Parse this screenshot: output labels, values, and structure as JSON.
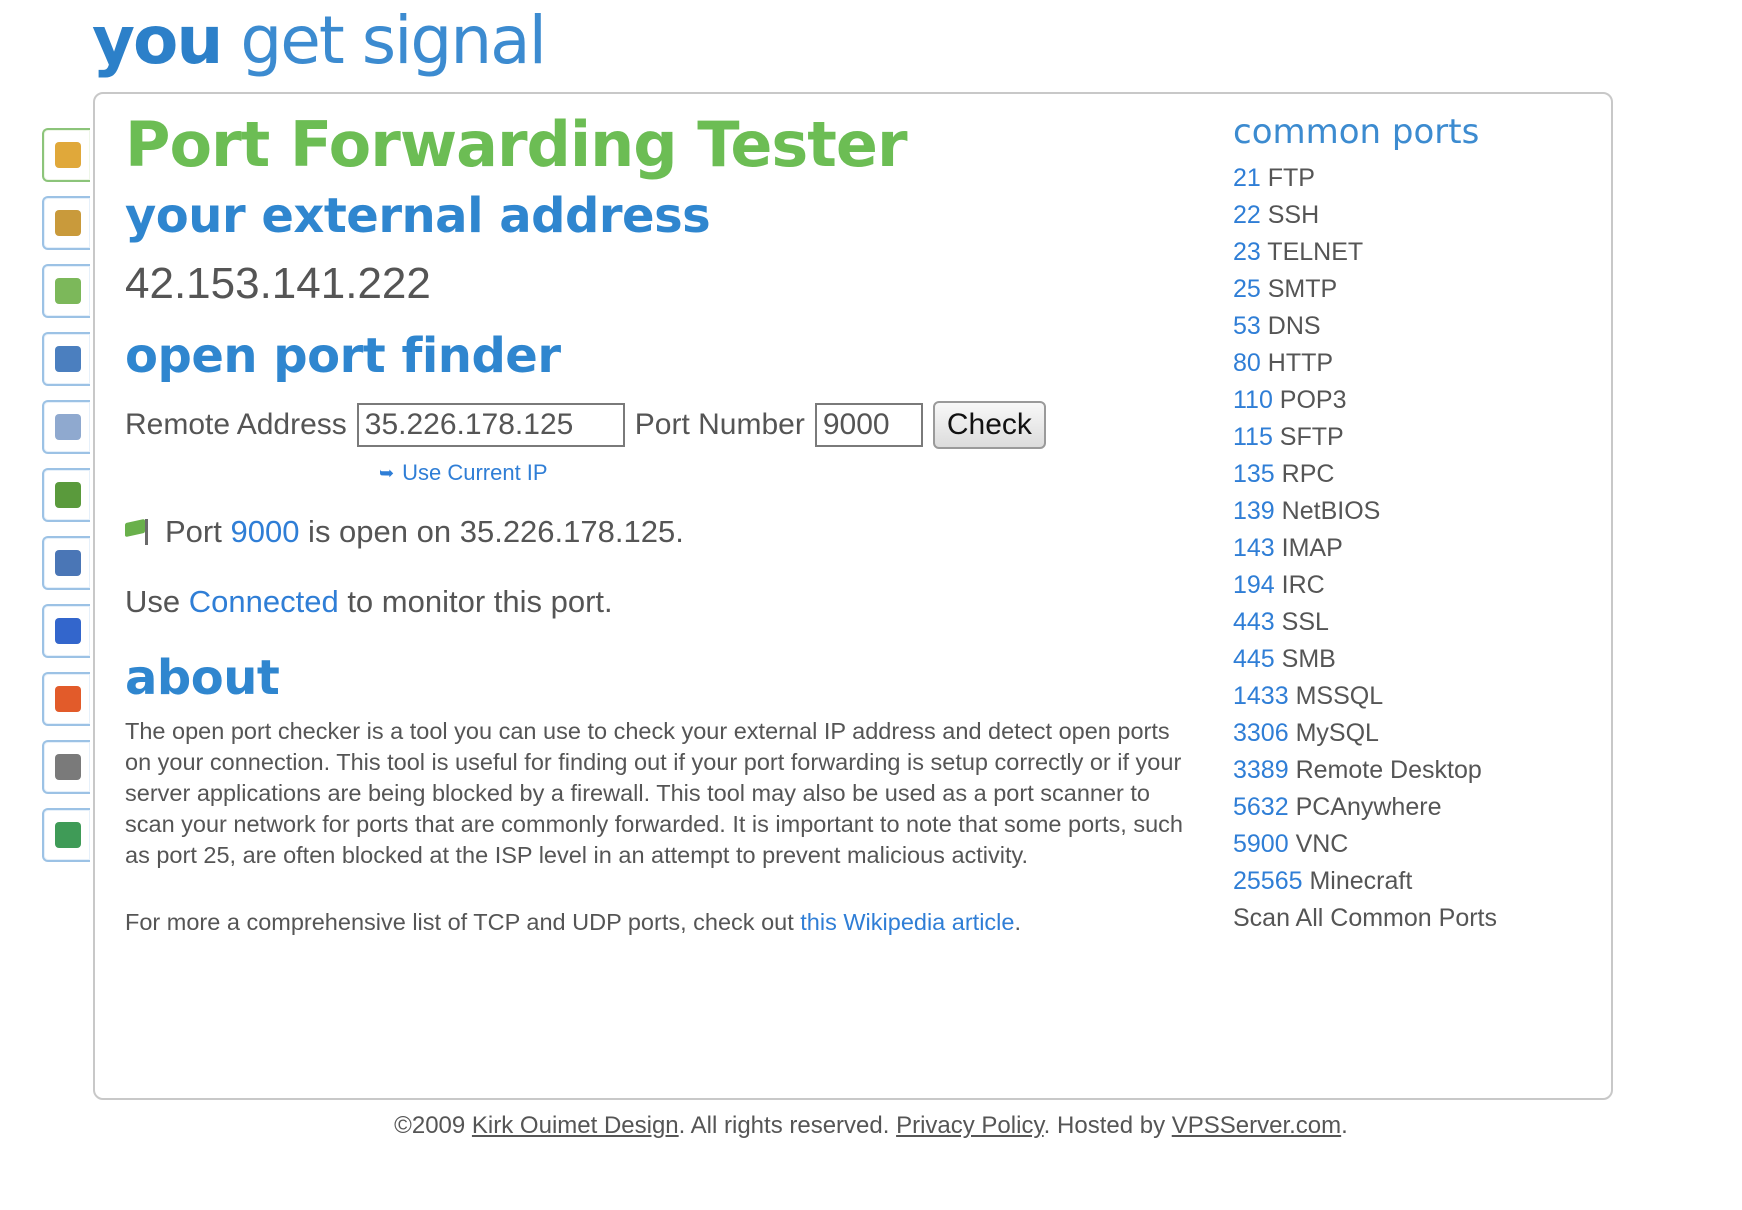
{
  "logo": {
    "you": "you",
    "rest": "get signal"
  },
  "sidebar": {
    "items": [
      {
        "icon": "lock-icon",
        "color": "#e0a83a"
      },
      {
        "icon": "map-icon",
        "color": "#c99a3b"
      },
      {
        "icon": "map-route-icon",
        "color": "#7cb85a"
      },
      {
        "icon": "phone-icon",
        "color": "#4b7fbf"
      },
      {
        "icon": "mail-icon",
        "color": "#8fa9cf"
      },
      {
        "icon": "network-icon",
        "color": "#5a9a3c"
      },
      {
        "icon": "help-icon",
        "color": "#4a76b6"
      },
      {
        "icon": "google-icon",
        "color": "#3366cc"
      },
      {
        "icon": "windows-icon",
        "color": "#e25b2a"
      },
      {
        "icon": "printer-icon",
        "color": "#7a7a7a"
      },
      {
        "icon": "globe-icon",
        "color": "#3f9b57"
      }
    ]
  },
  "main": {
    "title": "Port Forwarding Tester",
    "external_heading": "your external address",
    "external_ip": "42.153.141.222",
    "finder_heading": "open port finder",
    "form": {
      "remote_label": "Remote Address",
      "remote_value": "35.226.178.125",
      "port_label": "Port Number",
      "port_value": "9000",
      "check_label": "Check",
      "use_current_ip": "Use Current IP"
    },
    "result": {
      "prefix": "Port ",
      "port": "9000",
      "suffix": " is open on 35.226.178.125."
    },
    "monitor": {
      "prefix": "Use ",
      "link": "Connected",
      "suffix": " to monitor this port."
    },
    "about_heading": "about",
    "about_text": "The open port checker is a tool you can use to check your external IP address and detect open ports on your connection. This tool is useful for finding out if your port forwarding is setup correctly or if your server applications are being blocked by a firewall. This tool may also be used as a port scanner to scan your network for ports that are commonly forwarded. It is important to note that some ports, such as port 25, are often blocked at the ISP level in an attempt to prevent malicious activity.",
    "more": {
      "prefix": "For more a comprehensive list of TCP and UDP ports, check out ",
      "link": "this Wikipedia article",
      "suffix": "."
    }
  },
  "common_ports": {
    "heading": "common ports",
    "items": [
      {
        "num": "21",
        "name": " FTP"
      },
      {
        "num": "22",
        "name": " SSH"
      },
      {
        "num": "23",
        "name": " TELNET"
      },
      {
        "num": "25",
        "name": " SMTP"
      },
      {
        "num": "53",
        "name": " DNS"
      },
      {
        "num": "80",
        "name": " HTTP"
      },
      {
        "num": "110",
        "name": " POP3"
      },
      {
        "num": "115",
        "name": " SFTP"
      },
      {
        "num": "135",
        "name": " RPC"
      },
      {
        "num": "139",
        "name": " NetBIOS"
      },
      {
        "num": "143",
        "name": " IMAP"
      },
      {
        "num": "194",
        "name": " IRC"
      },
      {
        "num": "443",
        "name": " SSL"
      },
      {
        "num": "445",
        "name": " SMB"
      },
      {
        "num": "1433",
        "name": " MSSQL"
      },
      {
        "num": "3306",
        "name": " MySQL"
      },
      {
        "num": "3389",
        "name": " Remote Desktop"
      },
      {
        "num": "5632",
        "name": " PCAnywhere"
      },
      {
        "num": "5900",
        "name": " VNC"
      },
      {
        "num": "25565",
        "name": " Minecraft"
      }
    ],
    "scan_all": "Scan All Common Ports"
  },
  "footer": {
    "copyright": "©2009 ",
    "company": "Kirk Ouimet Design",
    "rights": ". All rights reserved. ",
    "privacy": "Privacy Policy",
    "hosted": ". Hosted by ",
    "host": "VPSServer.com",
    "end": "."
  }
}
